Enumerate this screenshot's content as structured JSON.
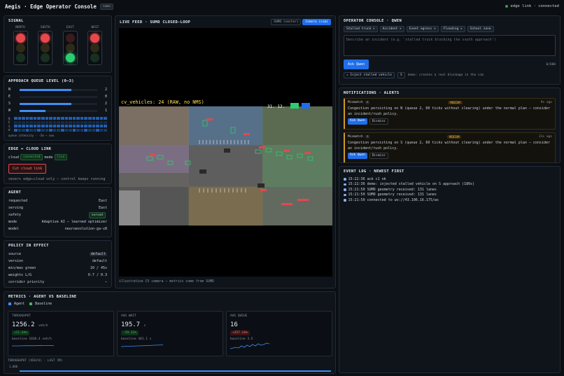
{
  "app": {
    "title": "Aegis · Edge Operator Console",
    "badge": "sumo",
    "status": "edge link · connected"
  },
  "signal": {
    "title": "SIGNAL",
    "lights": [
      {
        "label": "NORTH",
        "state": "red"
      },
      {
        "label": "SOUTH",
        "state": "red"
      },
      {
        "label": "EAST",
        "state": "green"
      },
      {
        "label": "WEST",
        "state": "red"
      }
    ]
  },
  "queue": {
    "title": "APPROACH QUEUE LEVEL (0–3)",
    "rows": [
      {
        "dir": "N",
        "value": "2",
        "fraction": 0.67
      },
      {
        "dir": "E",
        "value": "0",
        "fraction": 0.0
      },
      {
        "dir": "S",
        "value": "2",
        "fraction": 0.67
      },
      {
        "dir": "W",
        "value": "1",
        "fraction": 0.33
      }
    ],
    "heat_labels": [
      "N",
      "E",
      "S",
      "W"
    ],
    "caption": "queue intensity · -5m → now"
  },
  "edge": {
    "title": "EDGE ↔ CLOUD LINK",
    "cloud_label": "cloud",
    "cloud_state": "connected",
    "mode_label": "mode",
    "mode_state": "live",
    "cut_button": "Cut cloud link",
    "note": "severs edge↔cloud only — control keeps running"
  },
  "agent": {
    "title": "AGENT",
    "rows": [
      {
        "k": "requested",
        "v": "East"
      },
      {
        "k": "serving",
        "v": "East"
      },
      {
        "k": "safety",
        "v": "served"
      },
      {
        "k": "mode",
        "v": "Adaptive AI — learned optimizer"
      },
      {
        "k": "model",
        "v": "neuroevolution-ga-v8"
      }
    ]
  },
  "policy": {
    "title": "POLICY IN EFFECT",
    "rows": [
      {
        "k": "source",
        "v": "default"
      },
      {
        "k": "version",
        "v": "default"
      },
      {
        "k": "min/max green",
        "v": "10 / 45s"
      },
      {
        "k": "weights L/G",
        "v": "0.7 / 0.3"
      },
      {
        "k": "corridor priority",
        "v": "—"
      }
    ]
  },
  "feed": {
    "title": "LIVE FEED · SUMO CLOSED-LOOP",
    "tab_vector": "SUMO (vector)",
    "tab_camera": "Camera (sim)",
    "overlay_count": "cv_vehicles: 24  (RAW, no NMS)",
    "overlay_clock": "31. 12.",
    "caption": "illustrative CV camera — metrics come from SUMO"
  },
  "operator": {
    "title": "OPERATOR CONSOLE · QWEN",
    "chips": [
      "Stalled truck ×",
      "Accident ×",
      "Event egress ×",
      "Flooding ×",
      "School zone"
    ],
    "placeholder": "Describe an incident (e.g. 'stalled truck blocking the south approach')",
    "ask_button": "Ask Qwen",
    "counter": "0/600",
    "inject_button": "⚠ Inject stalled vehicle",
    "inject_dir": "S",
    "inject_note": "demo: creates a real blockage in the sim"
  },
  "notifications": {
    "title": "NOTIFICATIONS · ALERTS",
    "items": [
      {
        "kind": "Mismatch",
        "icon": "≡",
        "severity": "MEDIUM",
        "time": "9s ago",
        "text": "Congestion persisting on N (queue 2, 60 ticks without clearing) under the normal plan — consider an incident/rush policy.",
        "ask": "Ask Qwen",
        "dismiss": "Dismiss"
      },
      {
        "kind": "Mismatch",
        "icon": "≡",
        "severity": "MEDIUM",
        "time": "21s ago",
        "text": "Congestion persisting on S (queue 2, 60 ticks without clearing) under the normal plan — consider an incident/rush policy.",
        "ask": "Ask Qwen",
        "dismiss": "Dismiss"
      }
    ]
  },
  "eventlog": {
    "title": "EVENT LOG · NEWEST FIRST",
    "lines": [
      "15:22:36 ack c1 ok",
      "15:22:36 demo: injected stalled vehicle on S approach (180s)",
      "15:21:50 SUMO geometry received: 131 lanes",
      "15:21:50 SUMO geometry received: 131 lanes",
      "15:21:50 connected to ws://43.106.16.175/ws"
    ]
  },
  "metrics": {
    "title": "METRICS · AGENT VS BASELINE",
    "legend_agent": "Agent",
    "legend_baseline": "Baseline",
    "colors": {
      "agent": "#3f8ef0",
      "baseline": "#3fb950"
    },
    "cards": [
      {
        "label": "THROUGHPUT",
        "value": "1256.2",
        "unit": "veh/h",
        "delta": "+21.64%",
        "dir": "up",
        "baseline": "baseline 1030.4 veh/h"
      },
      {
        "label": "AVG WAIT",
        "value": "195.7",
        "unit": "s",
        "delta": "-59.32%",
        "dir": "up",
        "baseline": "baseline 481.1 s"
      },
      {
        "label": "AVG QUEUE",
        "value": "16",
        "unit": "",
        "delta": "+357.14%",
        "dir": "down",
        "baseline": "baseline 3.5"
      }
    ],
    "chart_title": "THROUGHPUT (VEH/H) · LAST 5M)",
    "chart_tick": "1,000"
  }
}
